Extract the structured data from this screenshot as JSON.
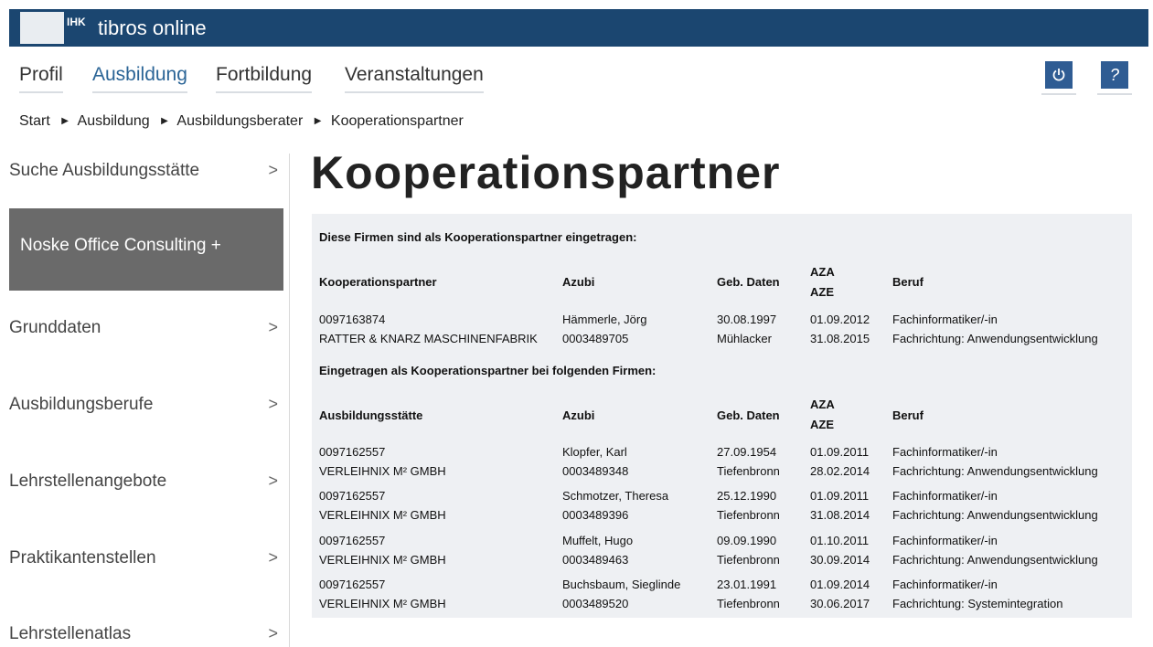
{
  "header": {
    "logo_text": "IHK",
    "app_title": "tibros online"
  },
  "nav": {
    "items": [
      "Profil",
      "Ausbildung",
      "Fortbildung",
      "Veranstaltungen"
    ],
    "active": "Ausbildung",
    "power_icon": "power-icon",
    "help_label": "?"
  },
  "breadcrumb": [
    "Start",
    "Ausbildung",
    "Ausbildungsberater",
    "Kooperationspartner"
  ],
  "sidebar": {
    "items": [
      {
        "label": "Suche Ausbildungsstätte",
        "chevron": true
      },
      {
        "label": "Noske Office Consulting +",
        "chevron": false,
        "active": true
      },
      {
        "label": "Grunddaten",
        "chevron": true
      },
      {
        "label": "Ausbildungsberufe",
        "chevron": true
      },
      {
        "label": "Lehrstellenangebote",
        "chevron": true
      },
      {
        "label": "Praktikantenstellen",
        "chevron": true
      },
      {
        "label": "Lehrstellenatlas",
        "chevron": true
      }
    ],
    "chevron_glyph": ">"
  },
  "main": {
    "title": "Kooperationspartner",
    "section1": {
      "heading": "Diese Firmen sind als Kooperationspartner eingetragen:",
      "headers": [
        "Kooperationspartner",
        "Azubi",
        "Geb. Daten",
        "AZA",
        "AZE",
        "Beruf"
      ],
      "rows": [
        {
          "line1": [
            "0097163874",
            "Hämmerle, Jörg",
            "30.08.1997",
            "01.09.2012",
            "Fachinformatiker/-in"
          ],
          "line2": [
            "RATTER & KNARZ MASCHINENFABRIK",
            "0003489705",
            "Mühlacker",
            "31.08.2015",
            "Fachrichtung: Anwendungsentwicklung"
          ]
        }
      ]
    },
    "section2": {
      "heading": "Eingetragen als Kooperationspartner bei folgenden Firmen:",
      "headers": [
        "Ausbildungsstätte",
        "Azubi",
        "Geb. Daten",
        "AZA",
        "AZE",
        "Beruf"
      ],
      "rows": [
        {
          "line1": [
            "0097162557",
            "Klopfer, Karl",
            "27.09.1954",
            "01.09.2011",
            "Fachinformatiker/-in"
          ],
          "line2": [
            "VERLEIHNIX M² GMBH",
            "0003489348",
            "Tiefenbronn",
            "28.02.2014",
            "Fachrichtung: Anwendungsentwicklung"
          ]
        },
        {
          "line1": [
            "0097162557",
            "Schmotzer, Theresa",
            "25.12.1990",
            "01.09.2011",
            "Fachinformatiker/-in"
          ],
          "line2": [
            "VERLEIHNIX M² GMBH",
            "0003489396",
            "Tiefenbronn",
            "31.08.2014",
            "Fachrichtung: Anwendungsentwicklung"
          ]
        },
        {
          "line1": [
            "0097162557",
            "Muffelt, Hugo",
            "09.09.1990",
            "01.10.2011",
            "Fachinformatiker/-in"
          ],
          "line2": [
            "VERLEIHNIX M² GMBH",
            "0003489463",
            "Tiefenbronn",
            "30.09.2014",
            "Fachrichtung: Anwendungsentwicklung"
          ]
        },
        {
          "line1": [
            "0097162557",
            "Buchsbaum, Sieglinde",
            "23.01.1991",
            "01.09.2014",
            "Fachinformatiker/-in"
          ],
          "line2": [
            "VERLEIHNIX M² GMBH",
            "0003489520",
            "Tiefenbronn",
            "30.06.2017",
            "Fachrichtung: Systemintegration"
          ]
        }
      ]
    }
  }
}
